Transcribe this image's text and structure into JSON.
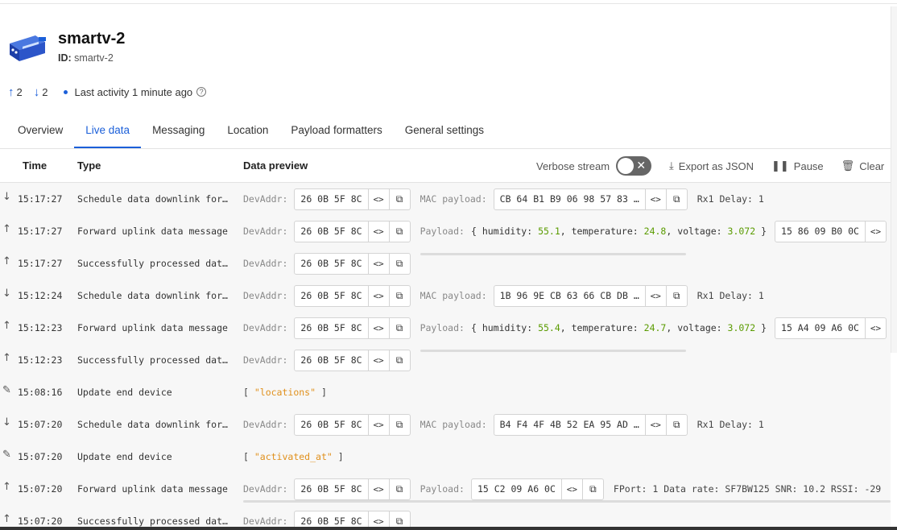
{
  "device": {
    "title": "smartv-2",
    "id_label": "ID:",
    "id_value": "smartv-2",
    "uplinks": "2",
    "downlinks": "2",
    "last_activity": "Last activity 1 minute ago"
  },
  "icons": {
    "up": "arrow-up-icon",
    "down": "arrow-down-icon",
    "edit": "pencil-icon",
    "copy": "copy-icon",
    "code": "code-icon"
  },
  "colors": {
    "accent": "#1b5fd9",
    "number": "#5a9b00",
    "string": "#e0901c"
  },
  "tabs": [
    {
      "label": "Overview"
    },
    {
      "label": "Live data",
      "active": true
    },
    {
      "label": "Messaging"
    },
    {
      "label": "Location"
    },
    {
      "label": "Payload formatters"
    },
    {
      "label": "General settings"
    }
  ],
  "table": {
    "headers": {
      "time": "Time",
      "type": "Type",
      "preview": "Data preview"
    },
    "verbose": "Verbose stream",
    "export": "Export as JSON",
    "pause": "Pause",
    "clear": "Clear"
  },
  "rows": [
    {
      "dir": "down",
      "time": "15:17:27",
      "type": "Schedule data downlink for…",
      "devaddr": "26 0B 5F 8C",
      "mac": "CB 64 B1 B9 06 98 57 83 …",
      "extra": "Rx1 Delay: 1"
    },
    {
      "dir": "up",
      "time": "15:17:27",
      "type": "Forward uplink data message",
      "devaddr": "26 0B 5F 8C",
      "payload": {
        "humidity": "55.1",
        "temperature": "24.8",
        "voltage": "3.072"
      },
      "raw": "15 86 09 B0 0C"
    },
    {
      "dir": "up",
      "time": "15:17:27",
      "type": "Successfully processed dat…",
      "devaddr": "26 0B 5F 8C"
    },
    {
      "dir": "down",
      "time": "15:12:24",
      "type": "Schedule data downlink for…",
      "devaddr": "26 0B 5F 8C",
      "mac": "1B 96 9E CB 63 66 CB DB …",
      "extra": "Rx1 Delay: 1"
    },
    {
      "dir": "up",
      "time": "15:12:23",
      "type": "Forward uplink data message",
      "devaddr": "26 0B 5F 8C",
      "payload": {
        "humidity": "55.4",
        "temperature": "24.7",
        "voltage": "3.072"
      },
      "raw": "15 A4 09 A6 0C"
    },
    {
      "dir": "up",
      "time": "15:12:23",
      "type": "Successfully processed dat…",
      "devaddr": "26 0B 5F 8C"
    },
    {
      "dir": "edit",
      "time": "15:08:16",
      "type": "Update end device",
      "field": "\"locations\""
    },
    {
      "dir": "down",
      "time": "15:07:20",
      "type": "Schedule data downlink for…",
      "devaddr": "26 0B 5F 8C",
      "mac": "B4 F4 4F 4B 52 EA 95 AD …",
      "extra": "Rx1 Delay: 1"
    },
    {
      "dir": "edit",
      "time": "15:07:20",
      "type": "Update end device",
      "field": "\"activated_at\""
    },
    {
      "dir": "up",
      "time": "15:07:20",
      "type": "Forward uplink data message",
      "devaddr": "26 0B 5F 8C",
      "raw_payload": "15 C2 09 A6 0C",
      "extra": "FPort: 1  Data rate: SF7BW125  SNR: 10.2  RSSI: -29"
    },
    {
      "dir": "up",
      "time": "15:07:20",
      "type": "Successfully processed dat…",
      "devaddr": "26 0B 5F 8C"
    }
  ]
}
